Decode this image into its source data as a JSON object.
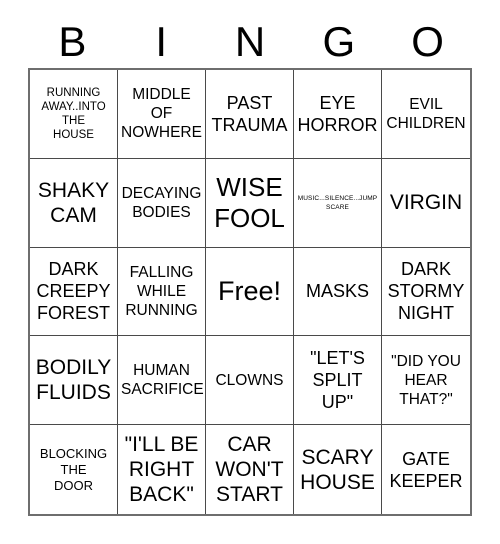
{
  "card": {
    "header_letters": [
      "B",
      "I",
      "N",
      "G",
      "O"
    ],
    "columns": 5,
    "rows": 5,
    "free_space_label": "Free!",
    "colors": {
      "text": "#000000",
      "background": "#ffffff",
      "grid_line": "#4a4a4a",
      "outer_border": "#6e6e6e"
    },
    "cells": [
      {
        "text": "RUNNING\nAWAY..INTO\nTHE\nHOUSE",
        "size": "fs-xs",
        "free": false
      },
      {
        "text": "MIDDLE\nOF\nNOWHERE",
        "size": "fs-m",
        "free": false
      },
      {
        "text": "PAST\nTRAUMA",
        "size": "fs-l",
        "free": false
      },
      {
        "text": "EYE\nHORROR",
        "size": "fs-l",
        "free": false
      },
      {
        "text": "EVIL\nCHILDREN",
        "size": "fs-m",
        "free": false
      },
      {
        "text": "SHAKY\nCAM",
        "size": "fs-xl",
        "free": false
      },
      {
        "text": "DECAYING\nBODIES",
        "size": "fs-m",
        "free": false
      },
      {
        "text": "WISE\nFOOL",
        "size": "fs-xxl",
        "free": false
      },
      {
        "text": "MUSIC...SILENCE...JUMP\nSCARE",
        "size": "fs-xxs",
        "free": false
      },
      {
        "text": "VIRGIN",
        "size": "fs-xl",
        "free": false
      },
      {
        "text": "DARK\nCREEPY\nFOREST",
        "size": "fs-l",
        "free": false
      },
      {
        "text": "FALLING\nWHILE\nRUNNING",
        "size": "fs-m",
        "free": false
      },
      {
        "text": "Free!",
        "size": "fs-free",
        "free": true
      },
      {
        "text": "MASKS",
        "size": "fs-l",
        "free": false
      },
      {
        "text": "DARK\nSTORMY\nNIGHT",
        "size": "fs-l",
        "free": false
      },
      {
        "text": "BODILY\nFLUIDS",
        "size": "fs-xl",
        "free": false
      },
      {
        "text": "HUMAN\nSACRIFICE",
        "size": "fs-m",
        "free": false
      },
      {
        "text": "CLOWNS",
        "size": "fs-m",
        "free": false
      },
      {
        "text": "\"LET'S\nSPLIT\nUP\"",
        "size": "fs-l",
        "free": false
      },
      {
        "text": "\"DID YOU\nHEAR\nTHAT?\"",
        "size": "fs-m",
        "free": false
      },
      {
        "text": "BLOCKING\nTHE\nDOOR",
        "size": "fs-s",
        "free": false
      },
      {
        "text": "\"I'LL BE\nRIGHT\nBACK\"",
        "size": "fs-xl",
        "free": false
      },
      {
        "text": "CAR\nWON'T\nSTART",
        "size": "fs-xl",
        "free": false
      },
      {
        "text": "SCARY\nHOUSE",
        "size": "fs-xl",
        "free": false
      },
      {
        "text": "GATE\nKEEPER",
        "size": "fs-l",
        "free": false
      }
    ]
  }
}
